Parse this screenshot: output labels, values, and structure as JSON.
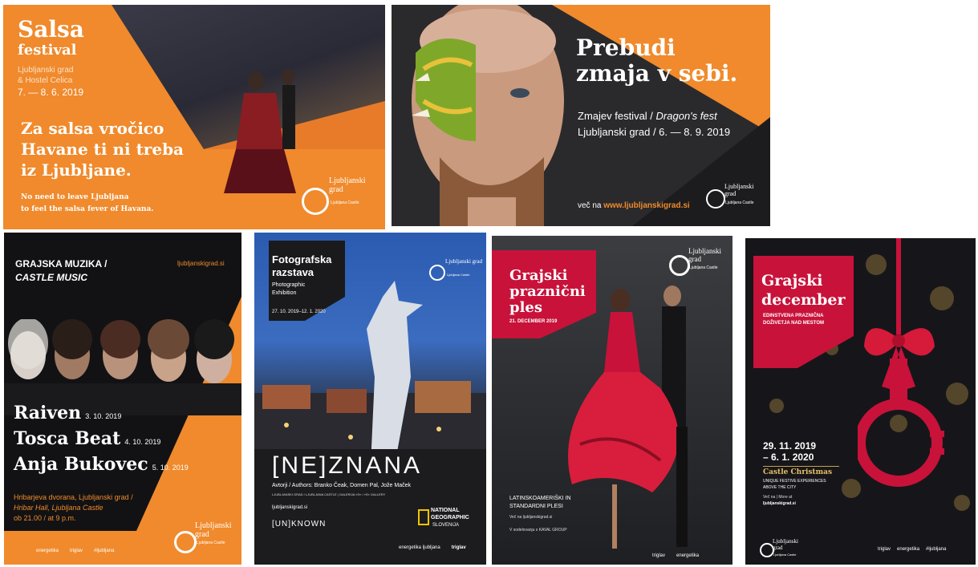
{
  "salsa": {
    "title": "Salsa",
    "subtitle": "festival",
    "venue1": "Ljubljanski grad",
    "venue2": "& Hostel Celica",
    "dates": "7. — 8. 6. 2019",
    "headline_l1": "Za salsa vročico",
    "headline_l2": "Havane ti ni treba",
    "headline_l3": "iz Ljubljane.",
    "en_l1": "No need to leave Ljubljana",
    "en_l2": "to feel the salsa fever of Havana.",
    "logo": "Ljubljanski grad",
    "logo_sub": "Ljubljana Castle"
  },
  "dragon": {
    "headline_l1": "Prebudi",
    "headline_l2": "zmaja v sebi.",
    "festival": "Zmajev festival /",
    "festival_en": "Dragon's fest",
    "place": "Ljubljanski grad / 6. — 8. 9. 2019",
    "more_prefix": "več na",
    "more_url": "www.ljubljanskigrad.si",
    "logo": "Ljubljanski grad",
    "logo_sub": "Ljubljana Castle"
  },
  "music": {
    "header_l1": "GRAJSKA MUZIKA /",
    "header_l2": "CASTLE MUSIC",
    "url": "ljubljanskigrad.si",
    "act1": "Raiven",
    "date1": "3. 10. 2019",
    "act2": "Tosca Beat",
    "date2": "4. 10. 2019",
    "act3": "Anja Bukovec",
    "date3": "5. 10. 2019",
    "hall_l1": "Hribarjeva dvorana, Ljubljanski grad /",
    "hall_l2": "Hribar Hall, Ljubljana Castle",
    "time": "ob 21.00 / at 9 p.m.",
    "logo": "Ljubljanski grad",
    "logo_sub": "Ljubljana Castle",
    "sponsors": [
      "energetika",
      "triglav",
      "#ljubljana"
    ]
  },
  "photo": {
    "title_l1": "Fotografska",
    "title_l2": "razstava",
    "sub_l1": "Photographic",
    "sub_l2": "Exhibition",
    "dates": "27. 10. 2019–12. 1. 2020",
    "logo": "Ljubljanski grad",
    "logo_sub": "Ljubljana Castle",
    "title_main": "[NE]ZNANA",
    "authors": "Avtorji / Authors: Branko Čeak, Domen Pal, Jože Maček",
    "gallery": "LJUBLJANSKI GRAD / LJUBLJANA CASTLE | GALERIJA »S« / »S« GALLERY",
    "url": "ljubljanskigrad.si",
    "title_en": "[UN]KNOWN",
    "ng_l1": "NATIONAL",
    "ng_l2": "GEOGRAPHIC",
    "ng_l3": "SLOVENIJA",
    "sponsors": [
      "energetika ljubljana",
      "triglav"
    ]
  },
  "dance": {
    "logo": "Ljubljanski grad",
    "logo_sub": "Ljubljana Castle",
    "title_l1": "Grajski",
    "title_l2": "praznični",
    "title_l3": "ples",
    "date": "21. DECEMBER 2019",
    "info_l1": "LATINSKOAMERIŠKI IN",
    "info_l2": "STANDARDNI PLESI",
    "url": "Več na ljubljanskigrad.si",
    "coop": "V sodelovanju s KAVAL GROUP",
    "sponsors": [
      "triglav",
      "energetika"
    ]
  },
  "december": {
    "logo": "Ljubljanski grad",
    "logo_sub": "Ljubljana Castle",
    "title_l1": "Grajski",
    "title_l2": "december",
    "sub_l1": "EDINSTVENA PRAZNIČNA",
    "sub_l2": "DOŽIVETJA NAD MESTOM",
    "dates_l1": "29. 11. 2019",
    "dates_l2": "– 6. 1. 2020",
    "en_title": "Castle Christmas",
    "en_l1": "UNIQUE FESTIVE EXPERIENCES",
    "en_l2": "ABOVE THE CITY",
    "more_l1": "Več na | More at",
    "more_l2": "ljubljanskigrad.si",
    "sponsors": [
      "triglav",
      "energetika",
      "#ljubljana"
    ]
  },
  "colors": {
    "orange": "#f08a2c",
    "dark": "#1f1f22",
    "crimson": "#c8123a"
  }
}
